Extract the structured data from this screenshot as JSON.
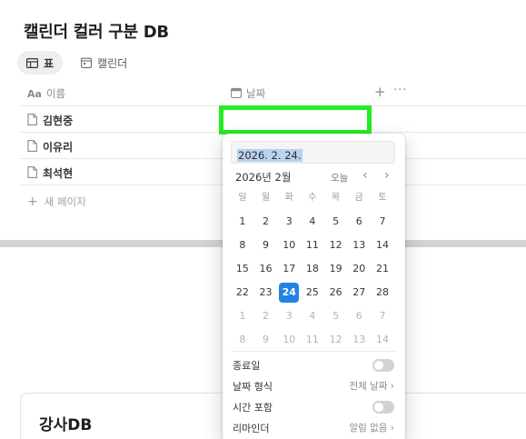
{
  "page": {
    "title": "캘린더 컬러 구분 DB"
  },
  "views": [
    {
      "label": "표",
      "icon": "table-icon",
      "active": true
    },
    {
      "label": "캘린더",
      "icon": "calendar-icon",
      "active": false
    }
  ],
  "table": {
    "columns": [
      {
        "label": "이름",
        "icon": "text-property-icon"
      },
      {
        "label": "날짜",
        "icon": "calendar-property-icon"
      }
    ],
    "add_column": "+",
    "more": "···",
    "rows": [
      {
        "name": "김현중"
      },
      {
        "name": "이유리"
      },
      {
        "name": "최석현"
      }
    ],
    "new_page": "새 페이지"
  },
  "date_picker": {
    "input_value": "2026. 2. 24.",
    "month_label": "2026년 2월",
    "today_label": "오늘",
    "prev": "‹",
    "next": "›",
    "weekdays": [
      "일",
      "월",
      "화",
      "수",
      "목",
      "금",
      "토"
    ],
    "weeks": [
      [
        "1",
        "2",
        "3",
        "4",
        "5",
        "6",
        "7"
      ],
      [
        "8",
        "9",
        "10",
        "11",
        "12",
        "13",
        "14"
      ],
      [
        "15",
        "16",
        "17",
        "18",
        "19",
        "20",
        "21"
      ],
      [
        "22",
        "23",
        "24",
        "25",
        "26",
        "27",
        "28"
      ],
      [
        "1",
        "2",
        "3",
        "4",
        "5",
        "6",
        "7"
      ],
      [
        "8",
        "9",
        "10",
        "11",
        "12",
        "13",
        "14"
      ]
    ],
    "selected_day": "24",
    "accent_color": "#2383e2",
    "options": {
      "end_date": "종료일",
      "date_format": "날짜 형식",
      "date_format_value": "전체 날짜",
      "include_time": "시간 포함",
      "reminder": "리마인더",
      "reminder_value": "알림 없음",
      "chevron": "›"
    }
  },
  "highlight_color": "#22ee22",
  "second_db": {
    "title": "강사DB"
  }
}
